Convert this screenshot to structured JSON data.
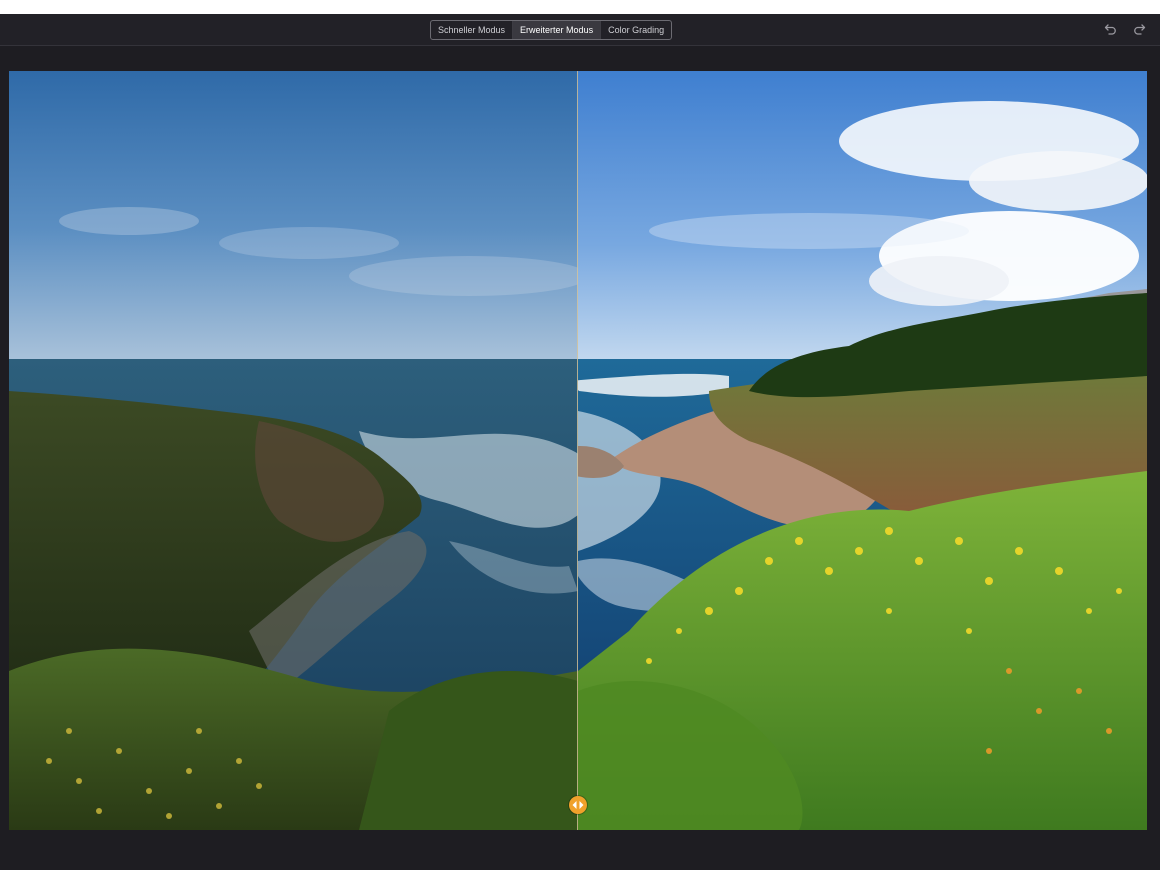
{
  "toolbar": {
    "modes": [
      {
        "label": "Schneller Modus",
        "active": false
      },
      {
        "label": "Erweiterter Modus",
        "active": true
      },
      {
        "label": "Color Grading",
        "active": false
      }
    ],
    "undo_icon": "undo-icon",
    "redo_icon": "redo-icon"
  },
  "viewer": {
    "mode": "before-after-split",
    "split_position": 0.5,
    "handle_color": "#f0a12b",
    "handle_icon": "left-right-arrows-icon"
  },
  "colors": {
    "app_bg": "#1e1d22",
    "toolbar_bg": "#222127",
    "active_tab_bg": "#3a3940"
  }
}
